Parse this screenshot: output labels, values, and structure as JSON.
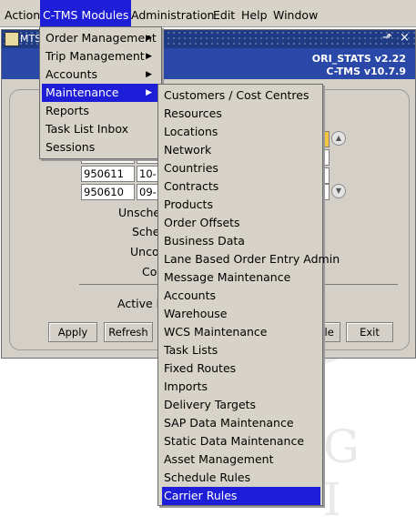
{
  "menubar": {
    "items": [
      {
        "label": "Action",
        "mnemonic": "A"
      },
      {
        "label": "C-TMS Modules",
        "mnemonic": "C"
      },
      {
        "label": "Administration",
        "mnemonic": "A"
      },
      {
        "label": "Edit",
        "mnemonic": "E"
      },
      {
        "label": "Help",
        "mnemonic": "H"
      },
      {
        "label": "Window",
        "mnemonic": "W"
      }
    ]
  },
  "window": {
    "title": "MTS",
    "version_line1": "ORI_STATS v2.22",
    "version_line2": "C-TMS v10.7.9",
    "close_glyph": "×",
    "minimize_glyph": "⬏"
  },
  "table": {
    "rows": [
      {
        "id": "950612",
        "date": "11-"
      },
      {
        "id": "950611",
        "date": "10-"
      },
      {
        "id": "950610",
        "date": "09-"
      }
    ]
  },
  "labels": {
    "unsche": "Unsche",
    "sche": "Sche",
    "unco": "Unco",
    "co": "Co",
    "active": "Active P"
  },
  "buttons": {
    "apply": "Apply",
    "refresh": "Refresh",
    "schedule_partial": "ule",
    "exit": "Exit"
  },
  "modules_menu": {
    "items": [
      {
        "label": "Order Management",
        "has_submenu": true
      },
      {
        "label": "Trip Management",
        "has_submenu": true
      },
      {
        "label": "Accounts",
        "has_submenu": true
      },
      {
        "label": "Maintenance",
        "has_submenu": true,
        "highlighted": true
      },
      {
        "label": "Reports",
        "has_submenu": false
      },
      {
        "label": "Task List Inbox",
        "has_submenu": false
      },
      {
        "label": "Sessions",
        "has_submenu": false
      }
    ]
  },
  "maintenance_menu": {
    "items": [
      "Customers / Cost Centres",
      "Resources",
      "Locations",
      "Network",
      "Countries",
      "Contracts",
      "Products",
      "Order Offsets",
      "Business Data",
      "Lane Based Order Entry Admin",
      "Message Maintenance",
      "Accounts",
      "Warehouse",
      "WCS Maintenance",
      "Task Lists",
      "Fixed Routes",
      "Imports",
      "Delivery Targets",
      "SAP Data Maintenance",
      "Static Data Maintenance",
      "Asset Management",
      "Schedule Rules",
      "Carrier Rules"
    ],
    "highlighted": "Carrier Rules"
  },
  "watermark": {
    "text": "G I"
  },
  "colors": {
    "menu_highlight": "#1e1ed8",
    "title_blue": "#2a48a8",
    "chrome": "#d4d0c8"
  }
}
